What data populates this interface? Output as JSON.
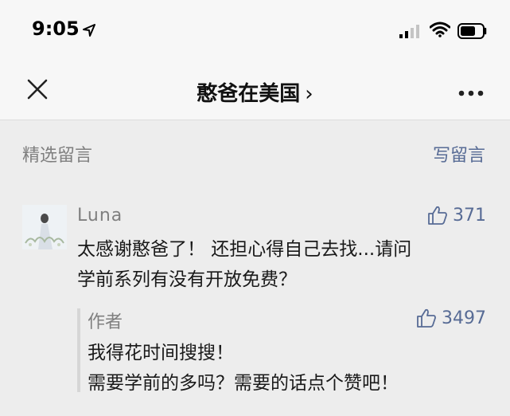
{
  "status": {
    "time": "9:05"
  },
  "nav": {
    "title": "憨爸在美国",
    "chevron": "›"
  },
  "section": {
    "label": "精选留言",
    "write_link": "写留言"
  },
  "comment": {
    "user": "Luna",
    "likes": "371",
    "lines": [
      "太感谢憨爸了！ 还担心得自己去找...请问",
      "学前系列有没有开放免费？"
    ]
  },
  "reply": {
    "author": "作者",
    "likes": "3497",
    "lines": [
      "我得花时间搜搜！",
      "需要学前的多吗？需要的话点个赞吧！"
    ]
  },
  "colors": {
    "link": "#576b95",
    "muted": "#7f7f7f",
    "background": "#ededed"
  },
  "icons": [
    "location-arrow-icon",
    "signal-icon",
    "wifi-icon",
    "battery-icon",
    "close-icon",
    "more-icon",
    "thumbs-up-icon"
  ]
}
